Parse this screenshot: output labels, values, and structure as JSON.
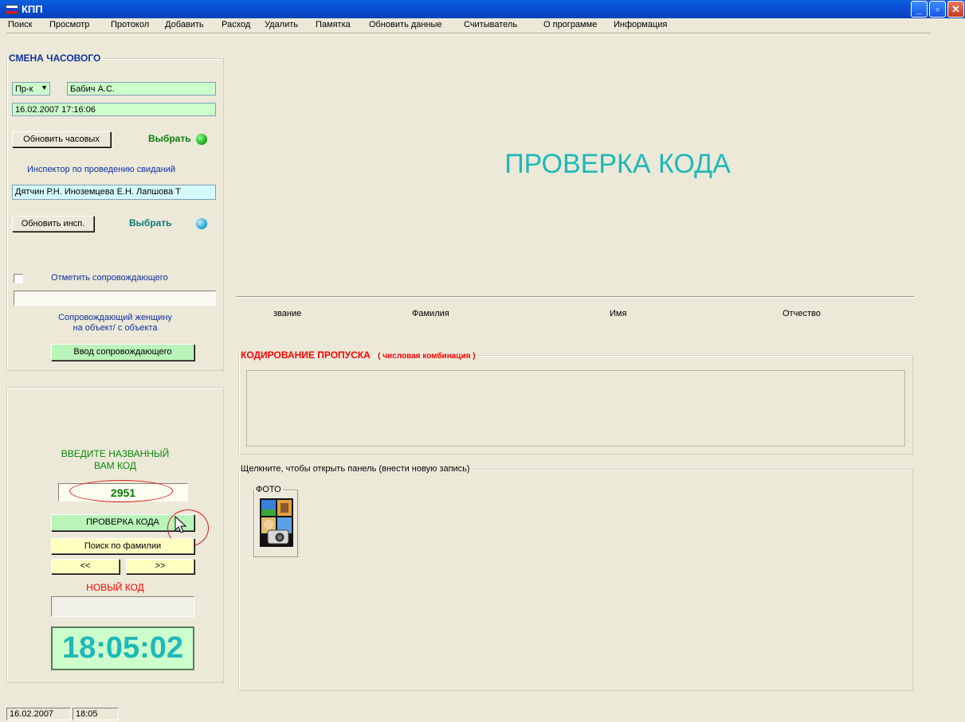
{
  "window": {
    "title": "КПП"
  },
  "menu": [
    "Поиск",
    "Просмотр",
    "Протокол",
    "Добавить",
    "Расход",
    "Удалить",
    "Памятка",
    "Обновить данные",
    "Считыватель",
    "О программе",
    "Информация"
  ],
  "guard_shift": {
    "legend": "СМЕНА ЧАСОВОГО",
    "rank_value": "Пр-к",
    "guard_name": "Бабич А.С.",
    "datetime": "16.02.2007 17:16:06",
    "refresh_guards_label": "Обновить часовых",
    "select_label": "Выбрать",
    "inspector_caption": "Инспектор по проведению свиданий",
    "inspectors": "Дятчин Р.Н. Иноземцева Е.Н. Лапшова Т",
    "refresh_inspector_label": "Обновить инсп.",
    "select_label_2": "Выбрать",
    "mark_escort_label": "Отметить сопровождающего",
    "escort_value": "",
    "escort_caption_line1": "Сопровождающий женщину",
    "escort_caption_line2": "на объект/ с объекта",
    "enter_escort_label": "Ввод сопровождающего"
  },
  "code_panel": {
    "prompt_line1": "ВВЕДИТЕ НАЗВАННЫЙ",
    "prompt_line2": "ВАМ КОД",
    "code_value": "2951",
    "check_code_label": "ПРОВЕРКА КОДА",
    "search_by_surname_label": "Поиск по фамилии",
    "prev_label": "<<",
    "next_label": ">>",
    "new_code_label": "НОВЫЙ КОД",
    "new_code_value": "",
    "clock": "18:05:02"
  },
  "main": {
    "heading": "ПРОВЕРКА КОДА",
    "columns": [
      "звание",
      "Фамилия",
      "Имя",
      "Отчество"
    ],
    "encoding_legend": "КОДИРОВАНИЕ ПРОПУСКА",
    "encoding_hint": "( числовая комбинация )",
    "panel_legend": "Щелкните, чтобы открыть панель (внести новую запись)",
    "photo_legend": "ФОТО"
  },
  "status": {
    "date": "16.02.2007",
    "time": "18:05"
  },
  "colors": {
    "accent_teal": "#1fb8b8",
    "green_field": "#ccffcc",
    "yellow_button": "#ffffc0",
    "red_label": "#ff0000"
  }
}
